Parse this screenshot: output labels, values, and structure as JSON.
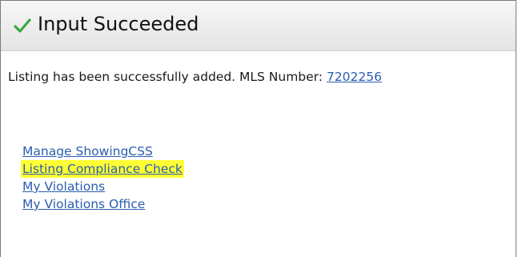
{
  "header": {
    "icon": "checkmark-icon",
    "title": "Input Succeeded"
  },
  "message": {
    "text": "Listing has been successfully added. MLS Number: ",
    "mls_number": "7202256"
  },
  "links": [
    {
      "label": "Manage ShowingCSS",
      "highlighted": false
    },
    {
      "label": "Listing Compliance Check",
      "highlighted": true
    },
    {
      "label": "My Violations",
      "highlighted": false
    },
    {
      "label": "My Violations Office",
      "highlighted": false
    }
  ],
  "colors": {
    "link": "#2a5db0",
    "highlight": "#ffff33",
    "check": "#3aa845"
  }
}
